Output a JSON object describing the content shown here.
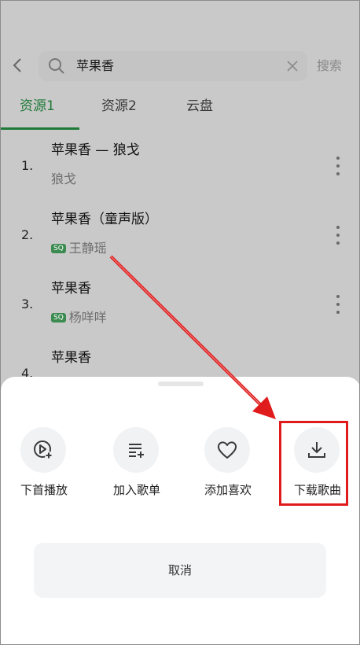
{
  "search": {
    "query": "苹果香",
    "button_label": "搜索"
  },
  "tabs": [
    {
      "label": "资源1"
    },
    {
      "label": "资源2"
    },
    {
      "label": "云盘"
    }
  ],
  "songs": [
    {
      "number": "1.",
      "title": "苹果香 — 狼戈",
      "artist": "狼戈",
      "badge": ""
    },
    {
      "number": "2.",
      "title": "苹果香（童声版）",
      "artist": "王静瑶",
      "badge": "SQ"
    },
    {
      "number": "3.",
      "title": "苹果香",
      "artist": "杨咩咩",
      "badge": "SQ"
    },
    {
      "number": "4.",
      "title": "苹果香",
      "artist": "",
      "badge": ""
    }
  ],
  "sheet": {
    "actions": [
      {
        "label": "下首播放",
        "icon": "play-next-icon"
      },
      {
        "label": "加入歌单",
        "icon": "add-to-playlist-icon"
      },
      {
        "label": "添加喜欢",
        "icon": "heart-icon"
      },
      {
        "label": "下载歌曲",
        "icon": "download-icon"
      }
    ],
    "cancel_label": "取消"
  },
  "colors": {
    "accent": "#1f7a38",
    "annotation": "#e01b1b",
    "overlay": "#c9c9c9"
  }
}
